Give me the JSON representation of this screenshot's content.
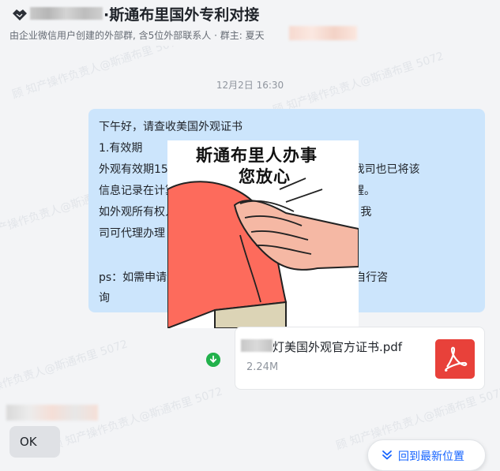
{
  "header": {
    "title": "·斯通布里国外专利对接",
    "subtitle": "由企业微信用户创建的外部群, 含5位外部联系人 · 群主: 夏天",
    "group_icon": "handshake-icon"
  },
  "chat": {
    "timestamp": "12月2日 16:30",
    "message_lines": [
      "下午好，请查收美国外观证书",
      "1.有效期",
      "外观有效期15年，至2040/11/25，中途无需续费。我司也已将该",
      "信息记录在计算机数据库中，中途有什么信息都会提醒。",
      "如外观所有权人名称/公司名称/公司地址等发生变更，我",
      "司可代理办理",
      "ps：如需申请，请联系当地市场监管局的知识产权科自行咨",
      "询"
    ],
    "sticker": {
      "line1": "斯通布里人办事",
      "line2": "您放心"
    },
    "file": {
      "name": "灯美国外观官方证书.pdf",
      "size": "2.24M",
      "icon": "pdf-icon",
      "status_icon": "download-complete-icon"
    },
    "reply": {
      "text": "OK"
    }
  },
  "jump_button": {
    "label": "回到最新位置",
    "icon": "double-chevron-down-icon"
  },
  "watermark": {
    "text": "顾 知产操作负责人@斯通布里 5072"
  },
  "colors": {
    "bubble": "#cce5fc",
    "accent": "#1664ff",
    "pdf": "#e8413a",
    "download": "#22b14c"
  }
}
